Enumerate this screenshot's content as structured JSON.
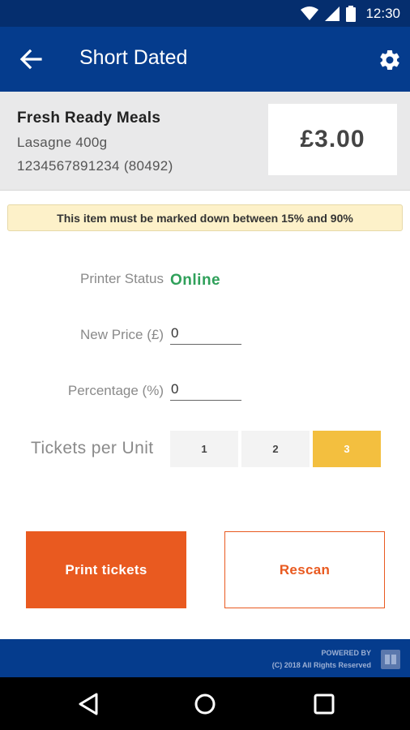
{
  "status_bar": {
    "time": "12:30",
    "icons": [
      "wifi-icon",
      "signal-icon",
      "battery-icon"
    ]
  },
  "app_bar": {
    "title": "Short Dated",
    "back_icon": "arrow-left-icon",
    "settings_icon": "gear-icon"
  },
  "product": {
    "category": "Fresh Ready Meals",
    "name": "Lasagne 400g",
    "code": "1234567891234  (80492)",
    "price": "£3.00"
  },
  "banner": {
    "text": "This item must be marked down between 15% and 90%"
  },
  "form": {
    "printer_status_label": "Printer Status",
    "printer_status_value": "Online",
    "new_price_label": "New Price (£)",
    "new_price_value": "0",
    "percentage_label": "Percentage (%)",
    "percentage_value": "0",
    "tickets_label": "Tickets per Unit",
    "tickets_options": [
      "1",
      "2",
      "3"
    ],
    "tickets_selected": "3"
  },
  "actions": {
    "print_label": "Print tickets",
    "rescan_label": "Rescan"
  },
  "footer": {
    "powered_by": "POWERED BY",
    "copyright": "(C) 2018 All Rights Reserved"
  },
  "colors": {
    "primary": "#053c8d",
    "status_bar": "#052e6e",
    "accent": "#e95a20",
    "selected": "#f3bf3f",
    "online": "#2fa05a",
    "banner_bg": "#fdf1c9"
  },
  "nav_bar": {
    "icons": [
      "back-triangle-icon",
      "home-circle-icon",
      "recents-square-icon"
    ]
  }
}
